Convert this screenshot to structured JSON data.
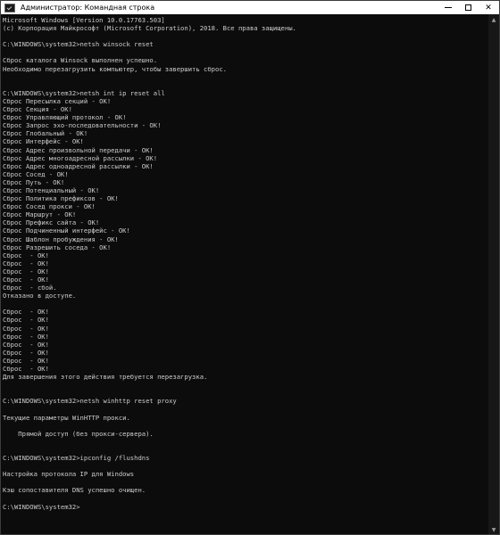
{
  "window": {
    "title": "Администратор: Командная строка",
    "icon": "cmd-icon",
    "controls": {
      "minimize": "minimize-icon",
      "maximize": "maximize-icon",
      "close": "✕"
    }
  },
  "console": {
    "lines": [
      "Microsoft Windows [Version 10.0.17763.503]",
      "(c) Корпорация Майкрософт (Microsoft Corporation), 2018. Все права защищены.",
      "",
      "C:\\WINDOWS\\system32>netsh winsock reset",
      "",
      "Сброс каталога Winsock выполнен успешно.",
      "Необходимо перезагрузить компьютер, чтобы завершить сброс.",
      "",
      "",
      "C:\\WINDOWS\\system32>netsh int ip reset all",
      "Сброс Пересылка секций - ОК!",
      "Сброс Секция - ОК!",
      "Сброс Управляющий протокол - ОК!",
      "Сброс Запрос эхо-последовательности - ОК!",
      "Сброс Глобальный - ОК!",
      "Сброс Интерфейс - ОК!",
      "Сброс Адрес произвольной передачи - ОК!",
      "Сброс Адрес многоадресной рассылки - ОК!",
      "Сброс Адрес одноадресной рассылки - ОК!",
      "Сброс Сосед - ОК!",
      "Сброс Путь - ОК!",
      "Сброс Потенциальный - ОК!",
      "Сброс Политика префиксов - ОК!",
      "Сброс Сосед прокси - ОК!",
      "Сброс Маршрут - ОК!",
      "Сброс Префикс сайта - ОК!",
      "Сброс Подчиненный интерфейс - ОК!",
      "Сброс Шаблон пробуждения - ОК!",
      "Сброс Разрешить соседа - ОК!",
      "Сброс  - ОК!",
      "Сброс  - ОК!",
      "Сброс  - ОК!",
      "Сброс  - ОК!",
      "Сброс  - сбой.",
      "Отказано в доступе.",
      "",
      "Сброс  - ОК!",
      "Сброс  - ОК!",
      "Сброс  - ОК!",
      "Сброс  - ОК!",
      "Сброс  - ОК!",
      "Сброс  - ОК!",
      "Сброс  - ОК!",
      "Сброс  - ОК!",
      "Для завершения этого действия требуется перезагрузка.",
      "",
      "",
      "C:\\WINDOWS\\system32>netsh winhttp reset proxy",
      "",
      "Текущие параметры WinHTTP прокси.",
      "",
      "    Прямой доступ (без прокси-сервера).",
      "",
      "",
      "C:\\WINDOWS\\system32>ipconfig /flushdns",
      "",
      "Настройка протокола IP для Windows",
      "",
      "Кэш сопоставителя DNS успешно очищен.",
      "",
      "C:\\WINDOWS\\system32>"
    ]
  },
  "colors": {
    "background": "#0c0c0c",
    "text": "#cccccc",
    "titlebar": "#ffffff"
  }
}
